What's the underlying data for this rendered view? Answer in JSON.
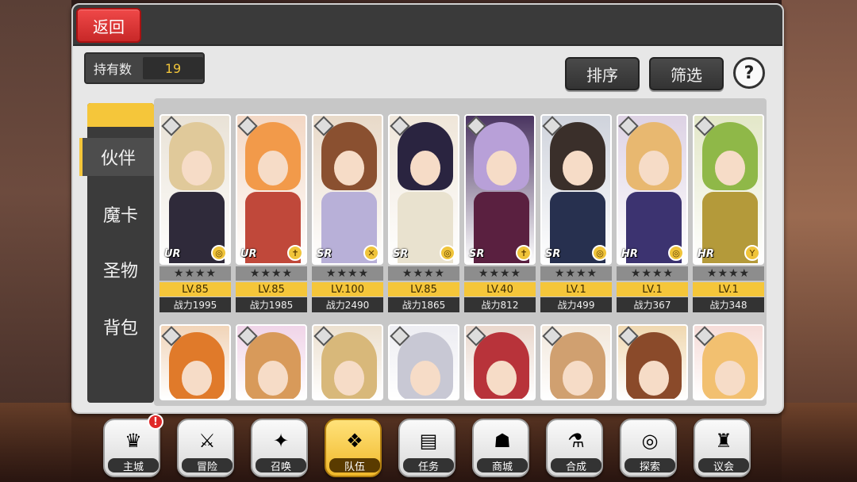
{
  "header": {
    "back_label": "返回"
  },
  "owned": {
    "label": "持有数",
    "value": "19"
  },
  "toolbar": {
    "sort_label": "排序",
    "filter_label": "筛选",
    "help_label": "?"
  },
  "tabs": [
    {
      "label": "伙伴",
      "active": true
    },
    {
      "label": "魔卡",
      "active": false
    },
    {
      "label": "圣物",
      "active": false
    },
    {
      "label": "背包",
      "active": false
    }
  ],
  "cards_row1": [
    {
      "rarity": "UR",
      "stars": "★★★★",
      "level": "LV.85",
      "power": "战力1995",
      "hair": "#e0c99a",
      "outfit": "#2f2a3a",
      "bg": "#e9e2d6",
      "icon": "◎"
    },
    {
      "rarity": "UR",
      "stars": "★★★★",
      "level": "LV.85",
      "power": "战力1985",
      "hair": "#f29a4a",
      "outfit": "#c0483a",
      "bg": "#f3d7c4",
      "icon": "✝"
    },
    {
      "rarity": "SR",
      "stars": "★★★★",
      "level": "LV.100",
      "power": "战力2490",
      "hair": "#8a5030",
      "outfit": "#b8b0d8",
      "bg": "#e8d9c8",
      "icon": "✕"
    },
    {
      "rarity": "SR",
      "stars": "★★★★",
      "level": "LV.85",
      "power": "战力1865",
      "hair": "#2a2440",
      "outfit": "#e9e2cf",
      "bg": "#efe6d9",
      "icon": "◎"
    },
    {
      "rarity": "SR",
      "stars": "★★★★",
      "level": "LV.40",
      "power": "战力812",
      "hair": "#b8a0d8",
      "outfit": "#5a2040",
      "bg": "#4a3460",
      "icon": "✝"
    },
    {
      "rarity": "SR",
      "stars": "★★★★",
      "level": "LV.1",
      "power": "战力499",
      "hair": "#3a2f2a",
      "outfit": "#27304f",
      "bg": "#cfd3dc",
      "icon": "◎"
    },
    {
      "rarity": "HR",
      "stars": "★★★★",
      "level": "LV.1",
      "power": "战力367",
      "hair": "#e8b870",
      "outfit": "#3c3370",
      "bg": "#ddd2e4",
      "icon": "◎"
    },
    {
      "rarity": "HR",
      "stars": "★★★★",
      "level": "LV.1",
      "power": "战力348",
      "hair": "#8fb848",
      "outfit": "#b49a3a",
      "bg": "#e3e7c8",
      "icon": "Y"
    }
  ],
  "cards_row2": [
    {
      "hair": "#e07a2a",
      "outfit": "#b4321e",
      "bg": "#f1d4b8"
    },
    {
      "hair": "#d89a5a",
      "outfit": "#8a3a7a",
      "bg": "#f0d4e8"
    },
    {
      "hair": "#d8b87a",
      "outfit": "#8a2a2a",
      "bg": "#ece0cf"
    },
    {
      "hair": "#c8c8d4",
      "outfit": "#e0e0e8",
      "bg": "#ededf2"
    },
    {
      "hair": "#b8333a",
      "outfit": "#6e5a3a",
      "bg": "#e9d7cc"
    },
    {
      "hair": "#d0a070",
      "outfit": "#f4f4f4",
      "bg": "#f2e8dc"
    },
    {
      "hair": "#8a4a2a",
      "outfit": "#2f7a7a",
      "bg": "#f0d8b0"
    },
    {
      "hair": "#f2c070",
      "outfit": "#e86a6a",
      "bg": "#f6dcd8"
    }
  ],
  "nav": [
    {
      "label": "主城",
      "icon": "♛",
      "active": false,
      "badge": "!"
    },
    {
      "label": "冒险",
      "icon": "⚔",
      "active": false
    },
    {
      "label": "召唤",
      "icon": "✦",
      "active": false
    },
    {
      "label": "队伍",
      "icon": "❖",
      "active": true
    },
    {
      "label": "任务",
      "icon": "▤",
      "active": false
    },
    {
      "label": "商城",
      "icon": "☗",
      "active": false
    },
    {
      "label": "合成",
      "icon": "⚗",
      "active": false
    },
    {
      "label": "探索",
      "icon": "◎",
      "active": false
    },
    {
      "label": "议会",
      "icon": "♜",
      "active": false
    }
  ],
  "colors": {
    "accent": "#f5c63a",
    "back_button": "#e03a3a",
    "badge": "#e02828"
  }
}
